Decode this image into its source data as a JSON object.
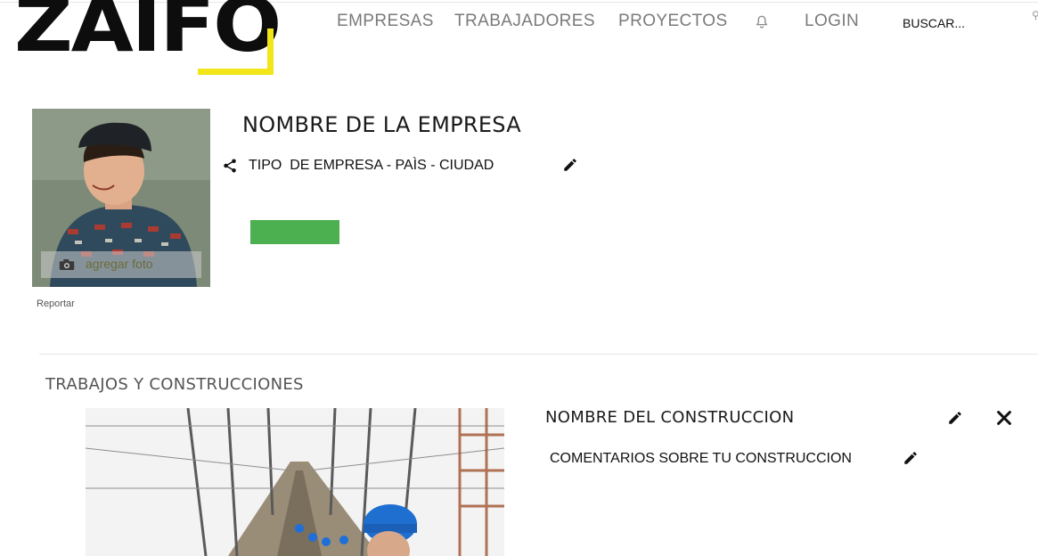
{
  "brand": {
    "logo_text": "ZAIFO",
    "accent_color": "#f2e51a"
  },
  "nav": {
    "items": [
      {
        "label": "EMPRESAS"
      },
      {
        "label": "TRABAJADORES"
      },
      {
        "label": "PROYECTOS"
      }
    ],
    "notifications_icon": "bell-icon",
    "login_label": "LOGIN",
    "search": {
      "placeholder": "BUSCAR...",
      "value": ""
    }
  },
  "profile": {
    "company_name": "NOMBRE DE LA EMPRESA",
    "meta": "TIPO  DE EMPRESA - PAÌS - CIUDAD",
    "add_photo_label": "agregar foto",
    "report_label": "Reportar",
    "action_color": "#4caf50"
  },
  "works": {
    "section_title": "TRABAJOS Y CONSTRUCCIONES",
    "items": [
      {
        "title": "NOMBRE DEL CONSTRUCCION",
        "comment": "COMENTARIOS SOBRE TU CONSTRUCCION"
      }
    ]
  }
}
